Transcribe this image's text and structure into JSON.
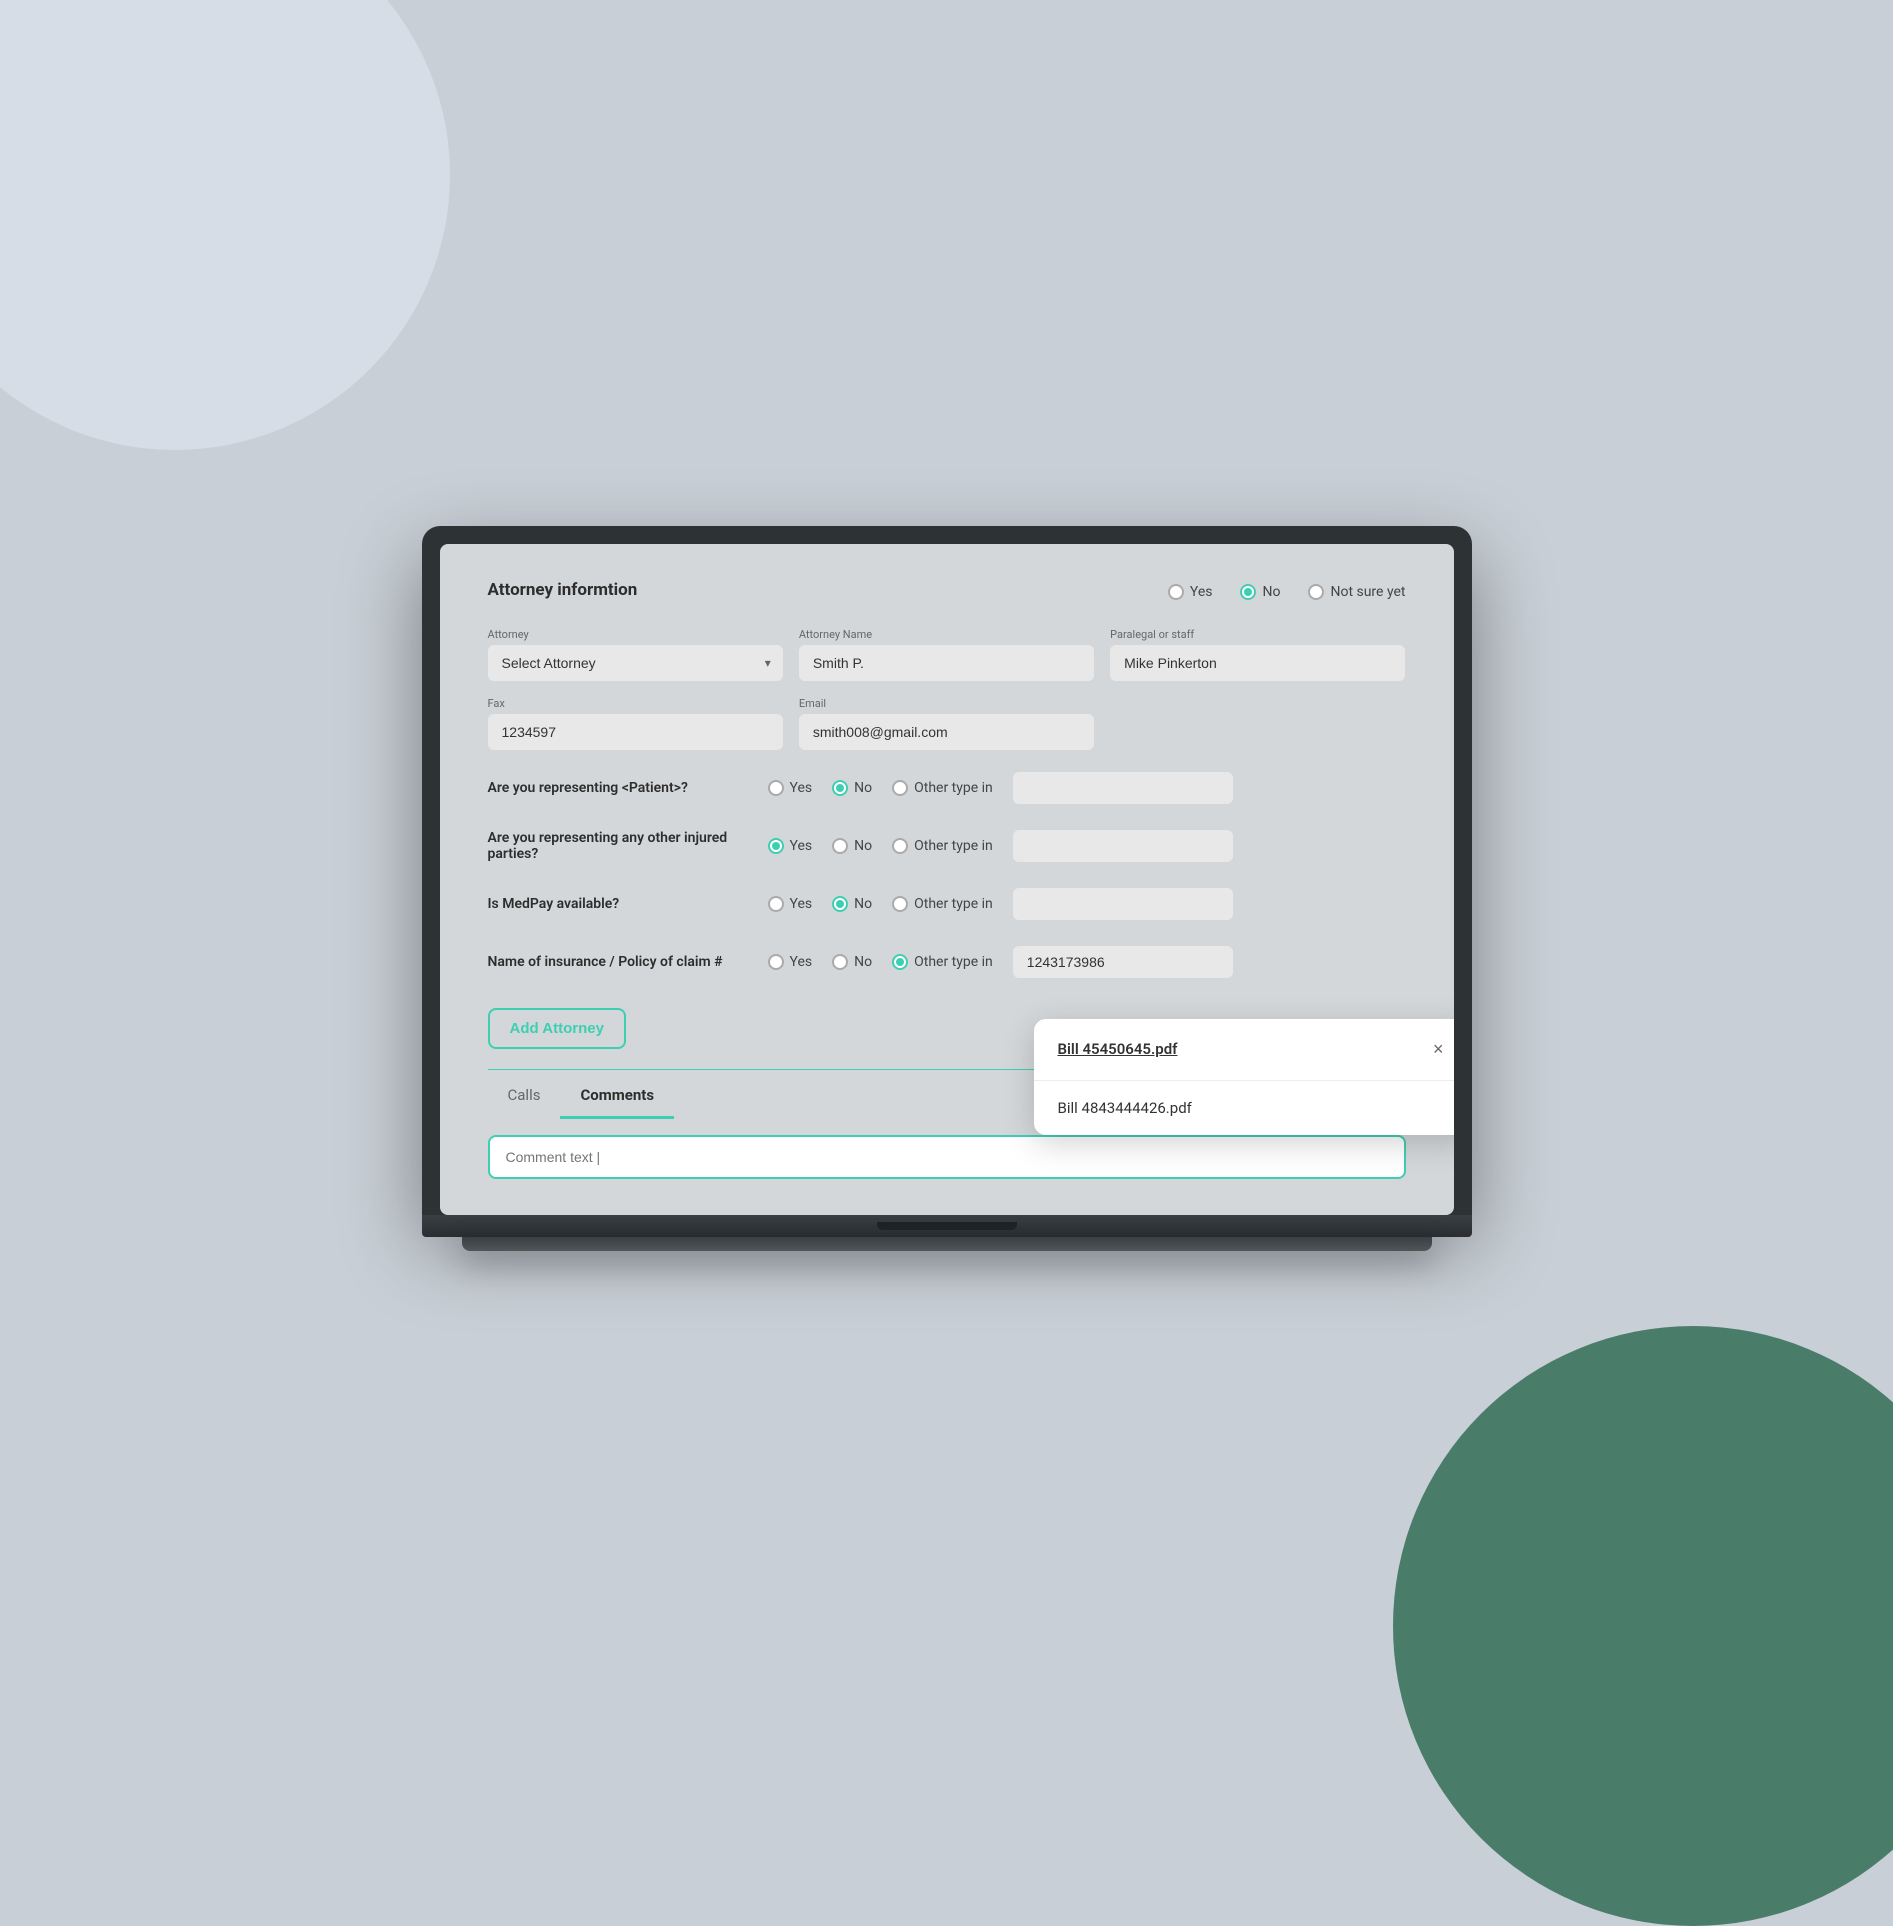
{
  "background": {
    "circleBlue": "light blue decorative circle",
    "circleGreen": "dark green decorative circle"
  },
  "section": {
    "title": "Attorney informtion",
    "topRadios": [
      {
        "label": "Yes",
        "checked": false
      },
      {
        "label": "No",
        "checked": true
      },
      {
        "label": "Not sure yet",
        "checked": false
      }
    ]
  },
  "form": {
    "attorney": {
      "label": "Attorney",
      "placeholder": "Select Attorney",
      "value": "Select Attorney"
    },
    "attorneyName": {
      "label": "Attorney Name",
      "value": "Smith P."
    },
    "paralegal": {
      "label": "Paralegal or staff",
      "value": "Mike Pinkerton"
    },
    "fax": {
      "label": "Fax",
      "value": "1234597"
    },
    "email": {
      "label": "Email",
      "value": "smith008@gmail.com"
    }
  },
  "questions": [
    {
      "label": "Are you representing <Patient>?",
      "radios": [
        {
          "label": "Yes",
          "checked": false
        },
        {
          "label": "No",
          "checked": true
        },
        {
          "label": "Other type in",
          "checked": false
        }
      ],
      "inputValue": ""
    },
    {
      "label": "Are you representing any other injured parties?",
      "radios": [
        {
          "label": "Yes",
          "checked": true
        },
        {
          "label": "No",
          "checked": false
        },
        {
          "label": "Other type in",
          "checked": false
        }
      ],
      "inputValue": ""
    },
    {
      "label": "Is MedPay available?",
      "radios": [
        {
          "label": "Yes",
          "checked": false
        },
        {
          "label": "No",
          "checked": true
        },
        {
          "label": "Other type in",
          "checked": false
        }
      ],
      "inputValue": ""
    },
    {
      "label": "Name of insurance / Policy of claim #",
      "radios": [
        {
          "label": "Yes",
          "checked": false
        },
        {
          "label": "No",
          "checked": false
        },
        {
          "label": "Other type in",
          "checked": true
        }
      ],
      "inputValue": "1243173986"
    }
  ],
  "addAttorneyBtn": "Add Attorney",
  "tabs": [
    {
      "label": "Calls",
      "active": false
    },
    {
      "label": "Comments",
      "active": true
    }
  ],
  "commentPlaceholder": "Comment text |",
  "popup": {
    "items": [
      {
        "label": "Bill 45450645.pdf",
        "isLink": true
      },
      {
        "label": "Bill 4843444426.pdf",
        "isLink": false
      }
    ],
    "closeBtn": "×"
  }
}
